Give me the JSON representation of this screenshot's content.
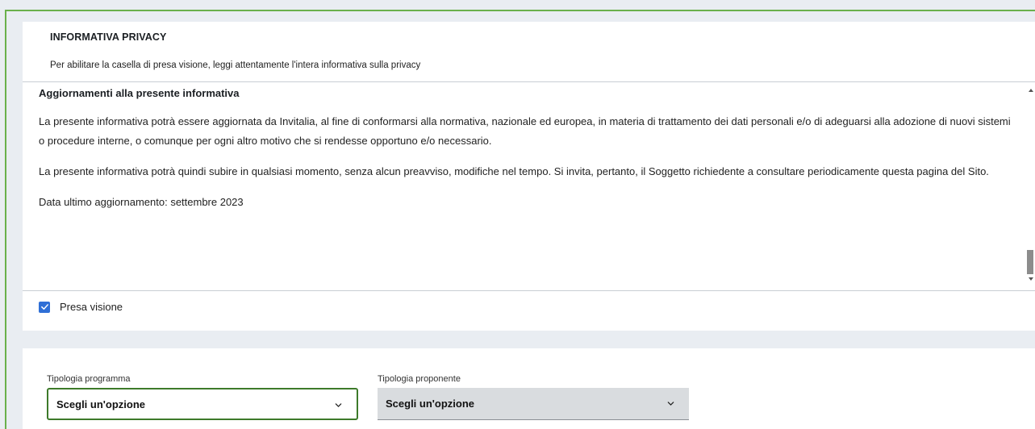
{
  "privacy": {
    "title": "INFORMATIVA PRIVACY",
    "subtitle": "Per abilitare la casella di presa visione, leggi attentamente l'intera informativa sulla privacy",
    "section_heading": "Aggiornamenti alla presente informativa",
    "paragraphs": [
      "La presente informativa potrà essere aggiornata da Invitalia, al fine di conformarsi alla normativa, nazionale ed europea, in materia di trattamento dei dati personali e/o di adeguarsi alla adozione di nuovi sistemi o procedure interne, o comunque per ogni altro motivo che si rendesse opportuno e/o necessario.",
      "La presente informativa potrà quindi subire in qualsiasi momento, senza alcun preavviso, modifiche nel tempo. Si invita, pertanto, il Soggetto richiedente a consultare periodicamente questa pagina del Sito.",
      "Data ultimo aggiornamento: settembre 2023"
    ],
    "consent_label": "Presa visione",
    "consent_checked": true
  },
  "filters": {
    "tipologia_programma": {
      "label": "Tipologia programma",
      "value": "Scegli un'opzione"
    },
    "tipologia_proponente": {
      "label": "Tipologia proponente",
      "value": "Scegli un'opzione"
    }
  },
  "colors": {
    "accent_green": "#6ab04c",
    "checkbox_blue": "#2f6fd6",
    "focus_border": "#3d7a2a"
  },
  "icons": {
    "checkbox": "check-icon",
    "dropdown": "chevron-down-icon"
  }
}
